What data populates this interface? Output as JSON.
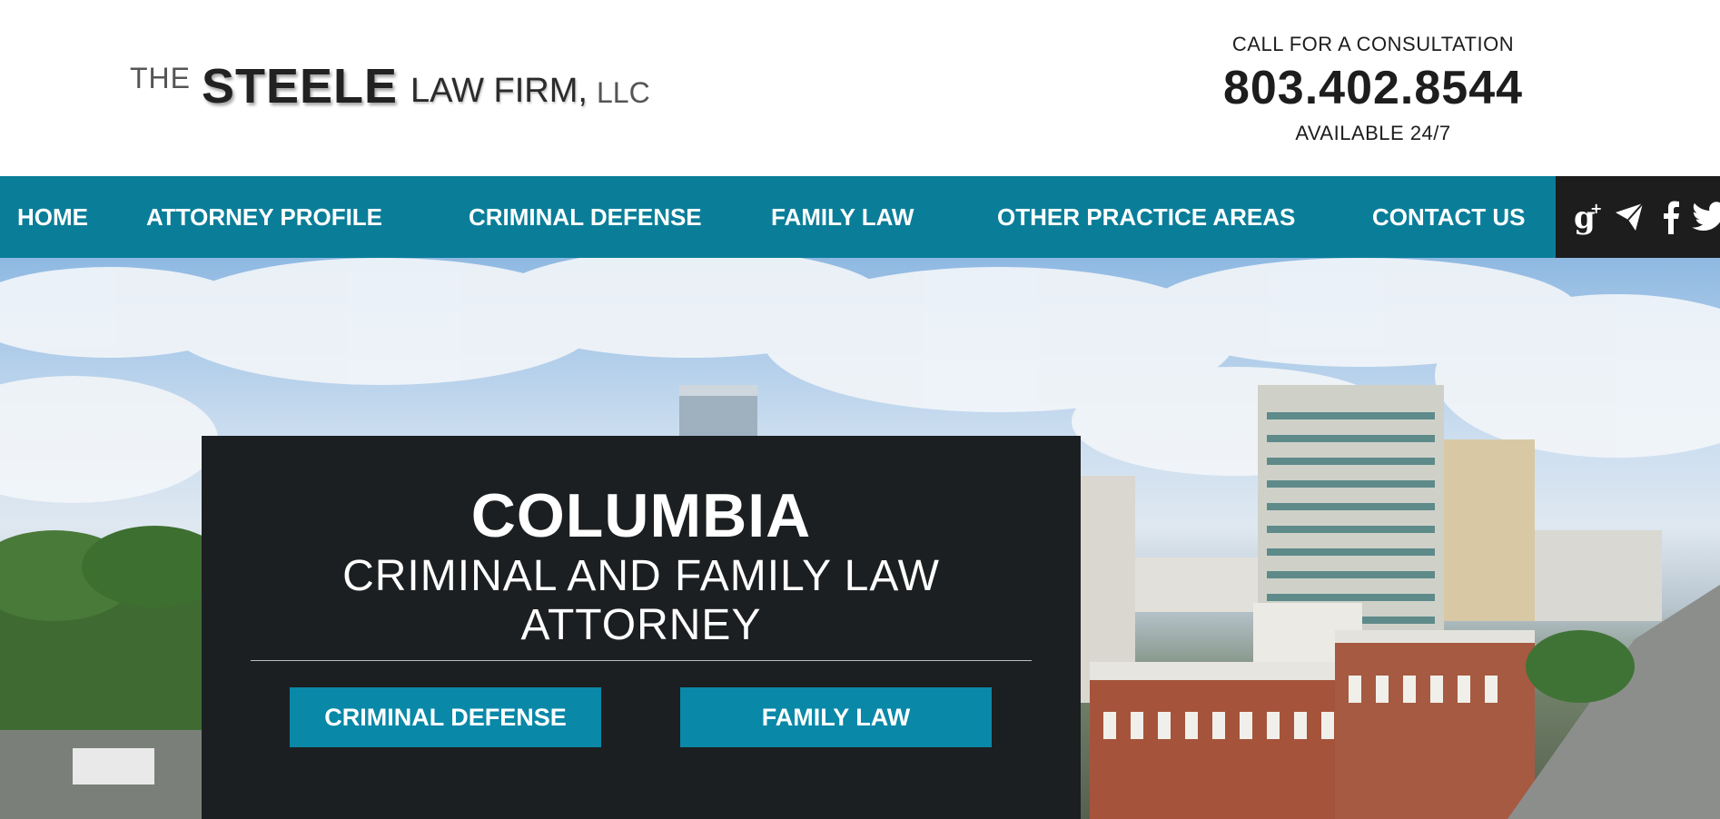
{
  "logo": {
    "the": "THE",
    "steele": "STEELE",
    "firm": "LAW FIRM,",
    "llc": "LLC"
  },
  "contact": {
    "call_label": "CALL FOR A CONSULTATION",
    "phone": "803.402.8544",
    "availability": "AVAILABLE 24/7"
  },
  "nav": {
    "items": [
      {
        "label": "HOME"
      },
      {
        "label": "ATTORNEY PROFILE"
      },
      {
        "label": "CRIMINAL DEFENSE"
      },
      {
        "label": "FAMILY LAW"
      },
      {
        "label": "OTHER PRACTICE AREAS"
      },
      {
        "label": "CONTACT US"
      }
    ],
    "social_icons": [
      "google-plus-icon",
      "send-icon",
      "facebook-icon",
      "twitter-icon"
    ]
  },
  "hero": {
    "title": "COLUMBIA",
    "subtitle": "CRIMINAL AND FAMILY LAW ATTORNEY",
    "buttons": [
      {
        "label": "CRIMINAL DEFENSE"
      },
      {
        "label": "FAMILY LAW"
      }
    ]
  },
  "colors": {
    "nav_background": "#0a7e99",
    "button_background": "#0a88a8",
    "hero_box": "#1c1f21",
    "social_bar": "#1d1d1d"
  }
}
